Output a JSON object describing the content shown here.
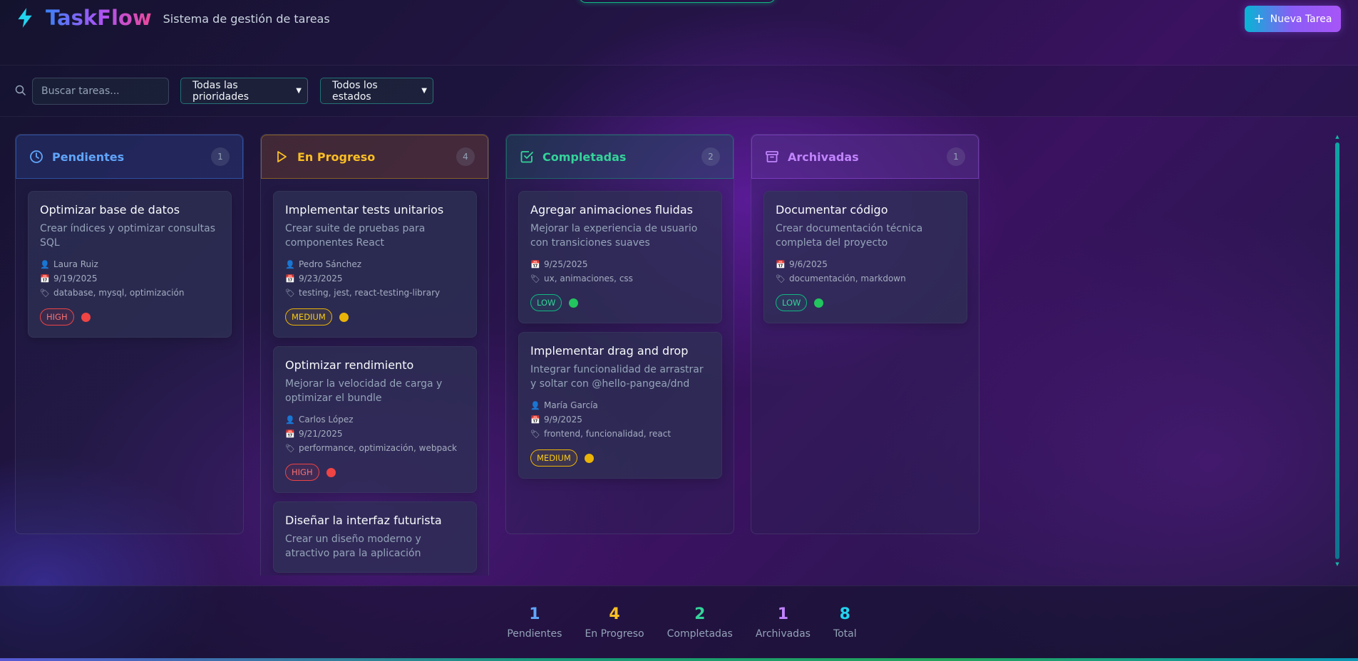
{
  "app": {
    "name": "TaskFlow",
    "subtitle": "Sistema de gestión de tareas",
    "new_task_label": "Nueva Tarea"
  },
  "filters": {
    "search_placeholder": "Buscar tareas...",
    "priority_selected": "Todas las prioridades",
    "state_selected": "Todos los estados"
  },
  "colors": {
    "pending": "#60a5fa",
    "in_progress": "#fbbf24",
    "completed": "#34d399",
    "archived": "#c084fc",
    "total": "#22d3ee"
  },
  "columns": [
    {
      "title": "Pendientes",
      "count": "1",
      "icon": "clock-icon",
      "cards": [
        {
          "title": "Optimizar base de datos",
          "description": "Crear índices y optimizar consultas SQL",
          "assignee": "Laura Ruiz",
          "date": "9/19/2025",
          "tags": "database, mysql, optimización",
          "priority": "HIGH"
        }
      ]
    },
    {
      "title": "En Progreso",
      "count": "4",
      "icon": "play-icon",
      "cards": [
        {
          "title": "Implementar tests unitarios",
          "description": "Crear suite de pruebas para componentes React",
          "assignee": "Pedro Sánchez",
          "date": "9/23/2025",
          "tags": "testing, jest, react-testing-library",
          "priority": "MEDIUM"
        },
        {
          "title": "Optimizar rendimiento",
          "description": "Mejorar la velocidad de carga y optimizar el bundle",
          "assignee": "Carlos López",
          "date": "9/21/2025",
          "tags": "performance, optimización, webpack",
          "priority": "HIGH"
        },
        {
          "title": "Diseñar la interfaz futurista",
          "description": "Crear un diseño moderno y atractivo para la aplicación"
        }
      ]
    },
    {
      "title": "Completadas",
      "count": "2",
      "icon": "check-square-icon",
      "cards": [
        {
          "title": "Agregar animaciones fluidas",
          "description": "Mejorar la experiencia de usuario con transiciones suaves",
          "date": "9/25/2025",
          "tags": "ux, animaciones, css",
          "priority": "LOW"
        },
        {
          "title": "Implementar drag and drop",
          "description": "Integrar funcionalidad de arrastrar y soltar con @hello-pangea/dnd",
          "assignee": "María García",
          "date": "9/9/2025",
          "tags": "frontend, funcionalidad, react",
          "priority": "MEDIUM"
        }
      ]
    },
    {
      "title": "Archivadas",
      "count": "1",
      "icon": "archive-icon",
      "cards": [
        {
          "title": "Documentar código",
          "description": "Crear documentación técnica completa del proyecto",
          "date": "9/6/2025",
          "tags": "documentación, markdown",
          "priority": "LOW"
        }
      ]
    }
  ],
  "stats": [
    {
      "value": "1",
      "label": "Pendientes"
    },
    {
      "value": "4",
      "label": "En Progreso"
    },
    {
      "value": "2",
      "label": "Completadas"
    },
    {
      "value": "1",
      "label": "Archivadas"
    },
    {
      "value": "8",
      "label": "Total"
    }
  ]
}
